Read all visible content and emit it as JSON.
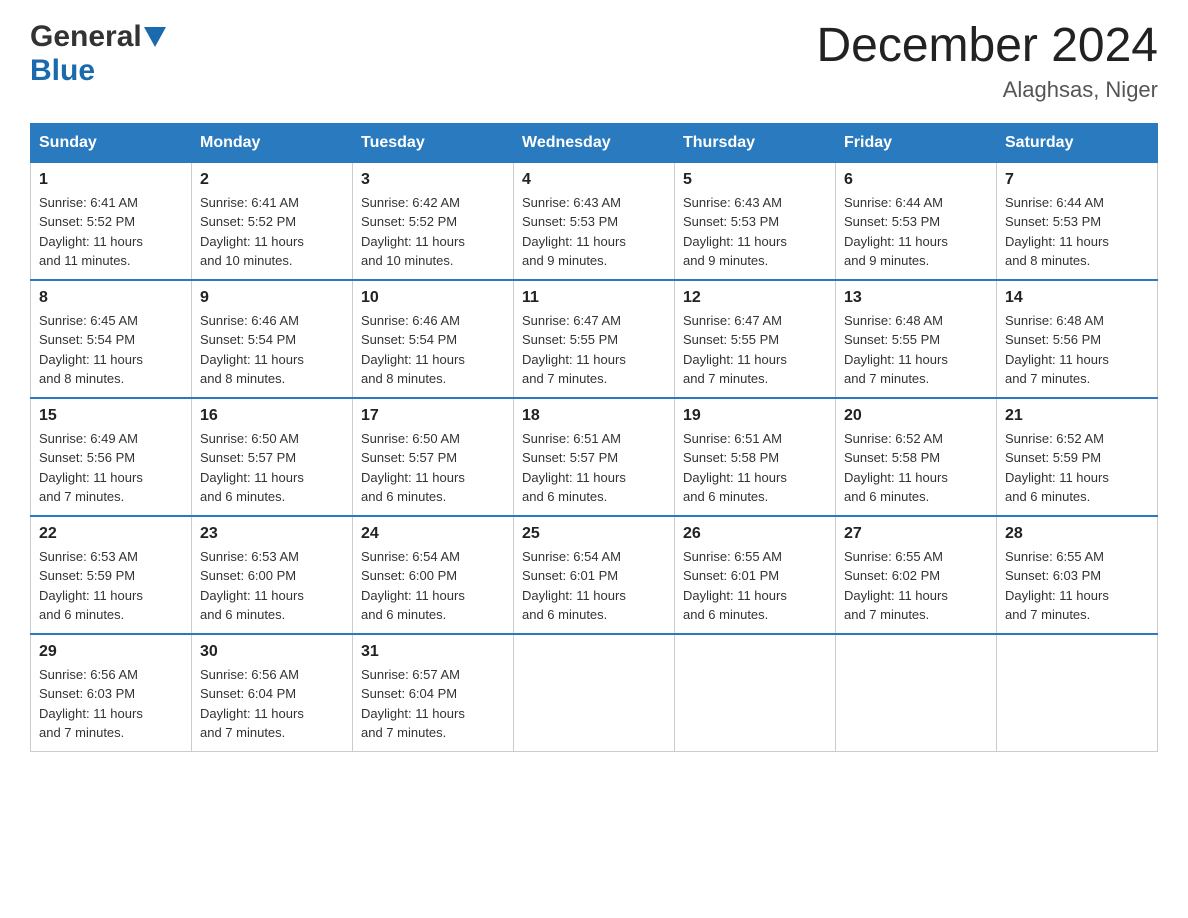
{
  "logo": {
    "general": "General",
    "blue": "Blue"
  },
  "title": "December 2024",
  "location": "Alaghsas, Niger",
  "weekdays": [
    "Sunday",
    "Monday",
    "Tuesday",
    "Wednesday",
    "Thursday",
    "Friday",
    "Saturday"
  ],
  "weeks": [
    [
      {
        "day": "1",
        "sunrise": "6:41 AM",
        "sunset": "5:52 PM",
        "daylight": "11 hours and 11 minutes."
      },
      {
        "day": "2",
        "sunrise": "6:41 AM",
        "sunset": "5:52 PM",
        "daylight": "11 hours and 10 minutes."
      },
      {
        "day": "3",
        "sunrise": "6:42 AM",
        "sunset": "5:52 PM",
        "daylight": "11 hours and 10 minutes."
      },
      {
        "day": "4",
        "sunrise": "6:43 AM",
        "sunset": "5:53 PM",
        "daylight": "11 hours and 9 minutes."
      },
      {
        "day": "5",
        "sunrise": "6:43 AM",
        "sunset": "5:53 PM",
        "daylight": "11 hours and 9 minutes."
      },
      {
        "day": "6",
        "sunrise": "6:44 AM",
        "sunset": "5:53 PM",
        "daylight": "11 hours and 9 minutes."
      },
      {
        "day": "7",
        "sunrise": "6:44 AM",
        "sunset": "5:53 PM",
        "daylight": "11 hours and 8 minutes."
      }
    ],
    [
      {
        "day": "8",
        "sunrise": "6:45 AM",
        "sunset": "5:54 PM",
        "daylight": "11 hours and 8 minutes."
      },
      {
        "day": "9",
        "sunrise": "6:46 AM",
        "sunset": "5:54 PM",
        "daylight": "11 hours and 8 minutes."
      },
      {
        "day": "10",
        "sunrise": "6:46 AM",
        "sunset": "5:54 PM",
        "daylight": "11 hours and 8 minutes."
      },
      {
        "day": "11",
        "sunrise": "6:47 AM",
        "sunset": "5:55 PM",
        "daylight": "11 hours and 7 minutes."
      },
      {
        "day": "12",
        "sunrise": "6:47 AM",
        "sunset": "5:55 PM",
        "daylight": "11 hours and 7 minutes."
      },
      {
        "day": "13",
        "sunrise": "6:48 AM",
        "sunset": "5:55 PM",
        "daylight": "11 hours and 7 minutes."
      },
      {
        "day": "14",
        "sunrise": "6:48 AM",
        "sunset": "5:56 PM",
        "daylight": "11 hours and 7 minutes."
      }
    ],
    [
      {
        "day": "15",
        "sunrise": "6:49 AM",
        "sunset": "5:56 PM",
        "daylight": "11 hours and 7 minutes."
      },
      {
        "day": "16",
        "sunrise": "6:50 AM",
        "sunset": "5:57 PM",
        "daylight": "11 hours and 6 minutes."
      },
      {
        "day": "17",
        "sunrise": "6:50 AM",
        "sunset": "5:57 PM",
        "daylight": "11 hours and 6 minutes."
      },
      {
        "day": "18",
        "sunrise": "6:51 AM",
        "sunset": "5:57 PM",
        "daylight": "11 hours and 6 minutes."
      },
      {
        "day": "19",
        "sunrise": "6:51 AM",
        "sunset": "5:58 PM",
        "daylight": "11 hours and 6 minutes."
      },
      {
        "day": "20",
        "sunrise": "6:52 AM",
        "sunset": "5:58 PM",
        "daylight": "11 hours and 6 minutes."
      },
      {
        "day": "21",
        "sunrise": "6:52 AM",
        "sunset": "5:59 PM",
        "daylight": "11 hours and 6 minutes."
      }
    ],
    [
      {
        "day": "22",
        "sunrise": "6:53 AM",
        "sunset": "5:59 PM",
        "daylight": "11 hours and 6 minutes."
      },
      {
        "day": "23",
        "sunrise": "6:53 AM",
        "sunset": "6:00 PM",
        "daylight": "11 hours and 6 minutes."
      },
      {
        "day": "24",
        "sunrise": "6:54 AM",
        "sunset": "6:00 PM",
        "daylight": "11 hours and 6 minutes."
      },
      {
        "day": "25",
        "sunrise": "6:54 AM",
        "sunset": "6:01 PM",
        "daylight": "11 hours and 6 minutes."
      },
      {
        "day": "26",
        "sunrise": "6:55 AM",
        "sunset": "6:01 PM",
        "daylight": "11 hours and 6 minutes."
      },
      {
        "day": "27",
        "sunrise": "6:55 AM",
        "sunset": "6:02 PM",
        "daylight": "11 hours and 7 minutes."
      },
      {
        "day": "28",
        "sunrise": "6:55 AM",
        "sunset": "6:03 PM",
        "daylight": "11 hours and 7 minutes."
      }
    ],
    [
      {
        "day": "29",
        "sunrise": "6:56 AM",
        "sunset": "6:03 PM",
        "daylight": "11 hours and 7 minutes."
      },
      {
        "day": "30",
        "sunrise": "6:56 AM",
        "sunset": "6:04 PM",
        "daylight": "11 hours and 7 minutes."
      },
      {
        "day": "31",
        "sunrise": "6:57 AM",
        "sunset": "6:04 PM",
        "daylight": "11 hours and 7 minutes."
      },
      null,
      null,
      null,
      null
    ]
  ],
  "labels": {
    "sunrise": "Sunrise:",
    "sunset": "Sunset:",
    "daylight": "Daylight:"
  }
}
